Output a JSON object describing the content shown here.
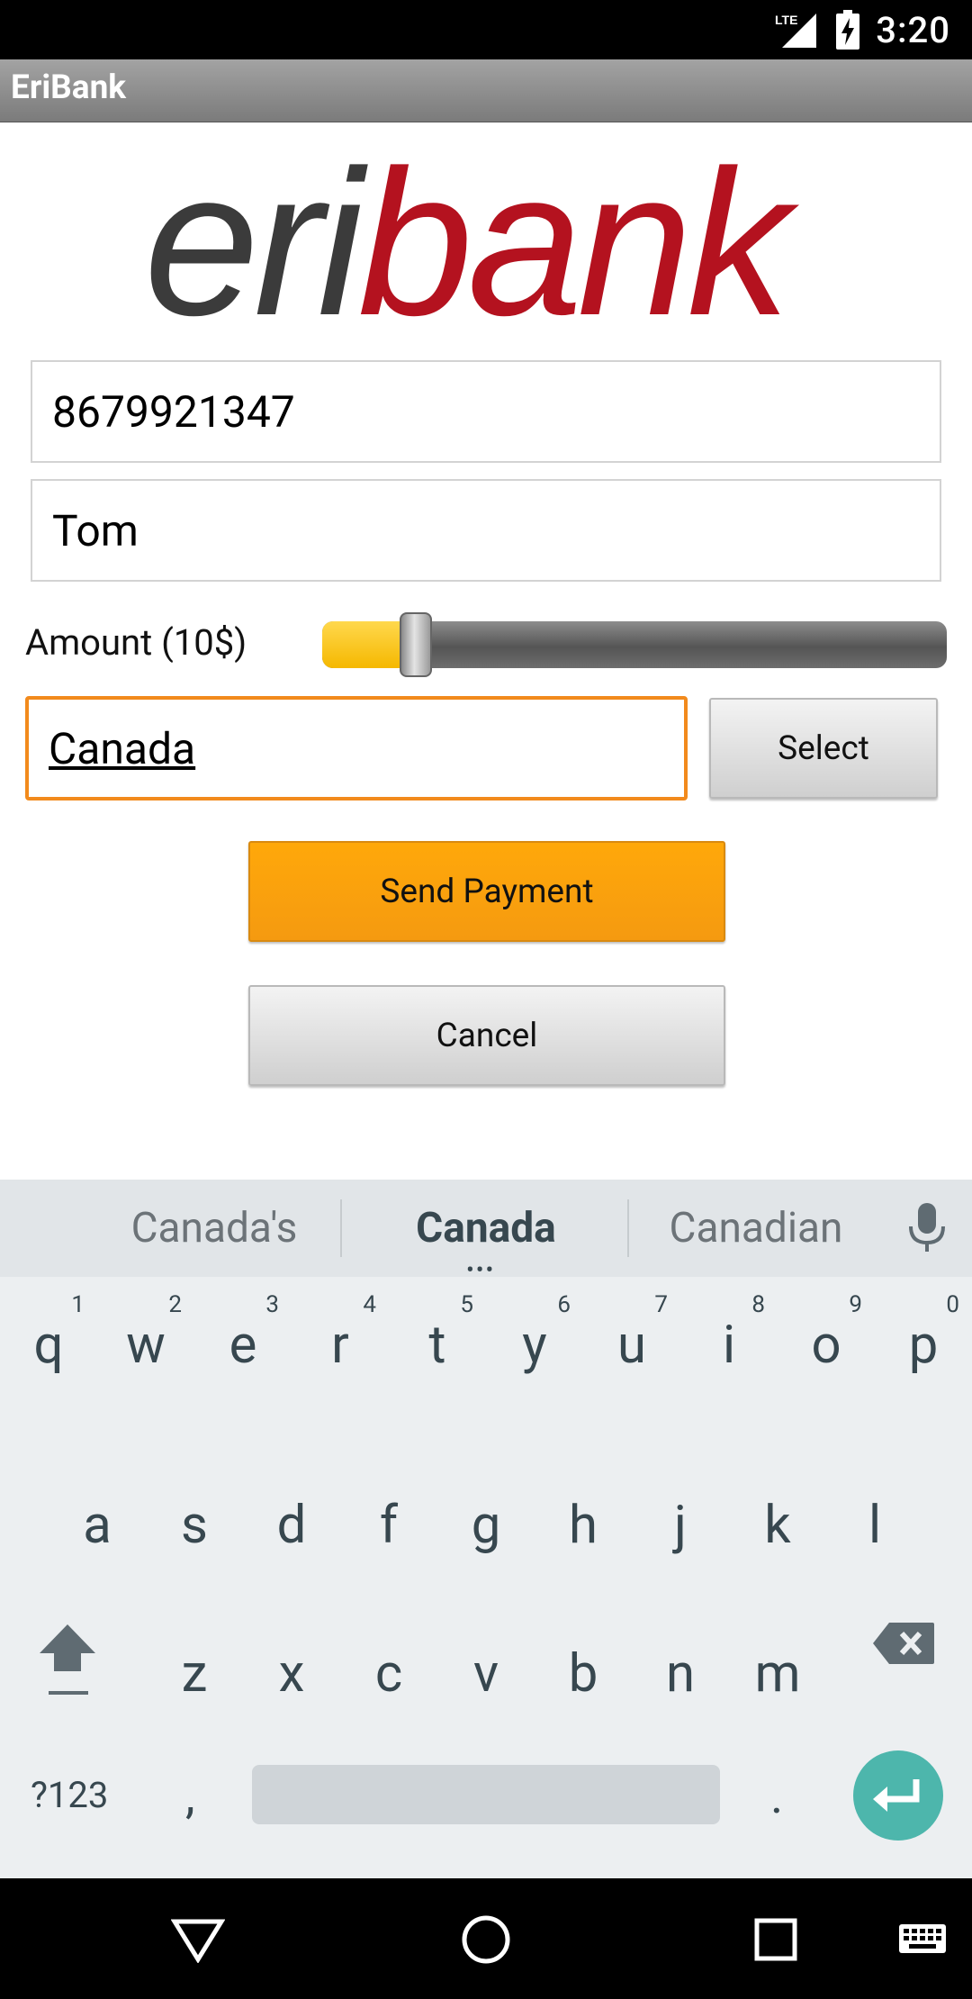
{
  "status_bar": {
    "time": "3:20",
    "network": "LTE"
  },
  "app": {
    "title": "EriBank"
  },
  "logo": {
    "part1": "eri",
    "part2": "bank"
  },
  "form": {
    "phone_value": "8679921347",
    "name_value": "Tom",
    "amount_label": "Amount (10$)",
    "amount_fraction": 0.13,
    "country_value": "Canada",
    "select_label": "Select",
    "send_label": "Send Payment",
    "cancel_label": "Cancel"
  },
  "keyboard": {
    "suggestions": [
      "Canada's",
      "Canada",
      "Canadian"
    ],
    "row1": [
      "q",
      "w",
      "e",
      "r",
      "t",
      "y",
      "u",
      "i",
      "o",
      "p"
    ],
    "row1_hints": [
      "1",
      "2",
      "3",
      "4",
      "5",
      "6",
      "7",
      "8",
      "9",
      "0"
    ],
    "row2": [
      "a",
      "s",
      "d",
      "f",
      "g",
      "h",
      "j",
      "k",
      "l"
    ],
    "row3": [
      "z",
      "x",
      "c",
      "v",
      "b",
      "n",
      "m"
    ],
    "symbols_label": "?123",
    "comma": ",",
    "period": "."
  },
  "colors": {
    "accent_orange": "#f28a1c",
    "send_button": "#ffa80a",
    "logo_red": "#b4121f",
    "enter_key": "#4db6ac"
  }
}
